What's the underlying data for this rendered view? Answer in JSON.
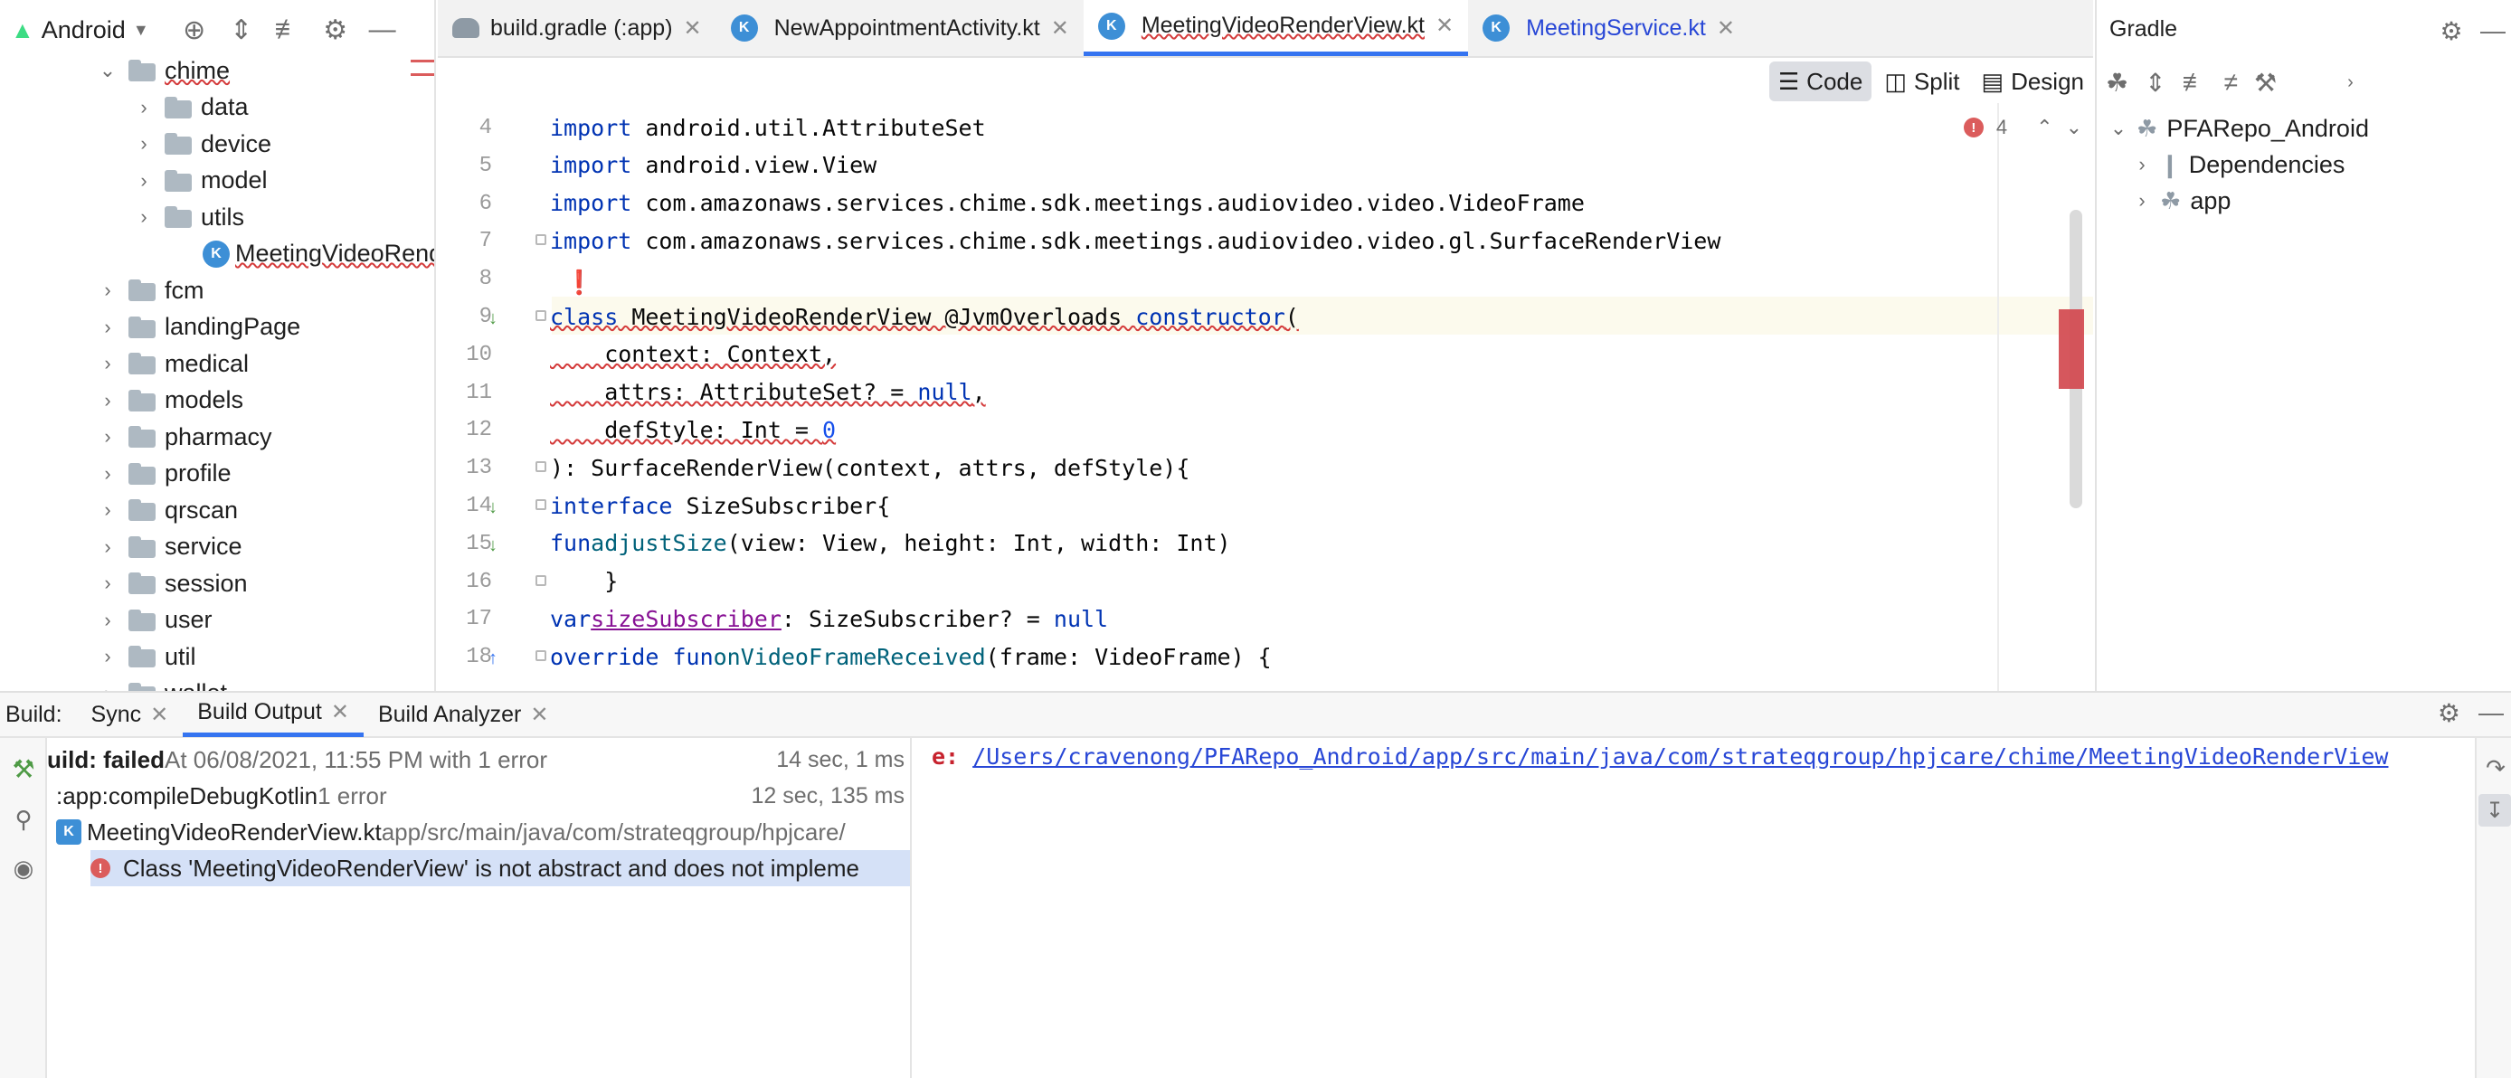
{
  "project_panel": {
    "view_label": "Android",
    "tree": [
      {
        "label": "chime",
        "level": 1,
        "expanded": true,
        "type": "folder",
        "squiggle": true
      },
      {
        "label": "data",
        "level": 2,
        "expanded": false,
        "type": "folder"
      },
      {
        "label": "device",
        "level": 2,
        "expanded": false,
        "type": "folder"
      },
      {
        "label": "model",
        "level": 2,
        "expanded": false,
        "type": "folder"
      },
      {
        "label": "utils",
        "level": 2,
        "expanded": false,
        "type": "folder"
      },
      {
        "label": "MeetingVideoRend",
        "level": 2,
        "expanded": false,
        "type": "kotlin-file",
        "squiggle": true
      },
      {
        "label": "fcm",
        "level": 0,
        "expanded": false,
        "type": "folder"
      },
      {
        "label": "landingPage",
        "level": 0,
        "expanded": false,
        "type": "folder"
      },
      {
        "label": "medical",
        "level": 0,
        "expanded": false,
        "type": "folder"
      },
      {
        "label": "models",
        "level": 0,
        "expanded": false,
        "type": "folder"
      },
      {
        "label": "pharmacy",
        "level": 0,
        "expanded": false,
        "type": "folder"
      },
      {
        "label": "profile",
        "level": 0,
        "expanded": false,
        "type": "folder"
      },
      {
        "label": "qrscan",
        "level": 0,
        "expanded": false,
        "type": "folder"
      },
      {
        "label": "service",
        "level": 0,
        "expanded": false,
        "type": "folder"
      },
      {
        "label": "session",
        "level": 0,
        "expanded": false,
        "type": "folder"
      },
      {
        "label": "user",
        "level": 0,
        "expanded": false,
        "type": "folder"
      },
      {
        "label": "util",
        "level": 0,
        "expanded": false,
        "type": "folder"
      },
      {
        "label": "wallet",
        "level": 0,
        "expanded": false,
        "type": "folder"
      }
    ]
  },
  "editor_tabs": [
    {
      "label": "build.gradle (:app)",
      "icon": "gradle-icon",
      "active": false
    },
    {
      "label": "NewAppointmentActivity.kt",
      "icon": "kotlin-file-icon",
      "active": false
    },
    {
      "label": "MeetingVideoRenderView.kt",
      "icon": "kotlin-file-icon",
      "active": true
    },
    {
      "label": "MeetingService.kt",
      "icon": "kotlin-file-icon",
      "active": false
    }
  ],
  "view_modes": {
    "code": "Code",
    "split": "Split",
    "design": "Design"
  },
  "inspection": {
    "error_count": "4"
  },
  "code_lines": [
    {
      "n": "4",
      "html": "<span class='kw'>import</span> android.util.AttributeSet"
    },
    {
      "n": "5",
      "html": "<span class='kw'>import</span> android.view.View"
    },
    {
      "n": "6",
      "html": "<span class='kw'>import</span> com.amazonaws.services.chime.sdk.meetings.audiovideo.video.VideoFrame"
    },
    {
      "n": "7",
      "html": "<span class='kw'>import</span> com.amazonaws.services.chime.sdk.meetings.audiovideo.video.gl.SurfaceRenderView"
    },
    {
      "n": "8",
      "html": ""
    },
    {
      "n": "9",
      "html": "<span class='kw squiggle'>class</span><span class='squiggle'> MeetingVideoRenderView @JvmOverloads </span><span class='kw squiggle'>constructor</span><span class='squiggle'>(</span>"
    },
    {
      "n": "10",
      "html": "<span class='squiggle'>    context: Context,</span>"
    },
    {
      "n": "11",
      "html": "<span class='squiggle'>    attrs: AttributeSet? = </span><span class='kw squiggle'>null</span><span class='squiggle'>,</span>"
    },
    {
      "n": "12",
      "html": "<span class='squiggle'>    defStyle: Int = </span><span class='num squiggle'>0</span>"
    },
    {
      "n": "13",
      "html": "): SurfaceRenderView(context, attrs, defStyle){"
    },
    {
      "n": "14",
      "html": "    <span class='kw'>interface</span> SizeSubscriber{"
    },
    {
      "n": "15",
      "html": "        <span class='kw'>fun</span> <span class='fn'>adjustSize</span>(view: View, height: Int, width: Int)"
    },
    {
      "n": "16",
      "html": "    }"
    },
    {
      "n": "17",
      "html": "    <span class='kw'>var</span> <span class='prop'>sizeSubscriber</span>: SizeSubscriber? = <span class='kw'>null</span>"
    },
    {
      "n": "18",
      "html": "    <span class='kw'>override fun</span> <span class='fn'>onVideoFrameReceived</span>(frame: VideoFrame) {"
    }
  ],
  "gradle": {
    "title": "Gradle",
    "tree": [
      {
        "label": "PFARepo_Android",
        "level": 0,
        "expanded": true
      },
      {
        "label": "Dependencies",
        "level": 1,
        "expanded": false
      },
      {
        "label": "app",
        "level": 1,
        "expanded": false
      }
    ]
  },
  "build": {
    "label": "Build:",
    "tabs": [
      {
        "label": "Sync",
        "active": false
      },
      {
        "label": "Build Output",
        "active": true
      },
      {
        "label": "Build Analyzer",
        "active": false
      }
    ],
    "rows": [
      {
        "main": "uild: failed",
        "detail": " At 06/08/2021, 11:55 PM with 1 error",
        "time": "14 sec, 1 ms"
      },
      {
        "main": ":app:compileDebugKotlin",
        "detail": "  1 error",
        "time": "12 sec, 135 ms"
      },
      {
        "main": "MeetingVideoRenderView.kt",
        "detail": " app/src/main/java/com/strateqgroup/hpjcare/",
        "time": ""
      },
      {
        "main": "Class 'MeetingVideoRenderView' is not abstract and does not impleme",
        "detail": "",
        "time": ""
      }
    ],
    "console": {
      "prefix": "e: ",
      "link": "/Users/cravenong/PFARepo_Android/app/src/main/java/com/strateqgroup/hpjcare/chime/MeetingVideoRenderView"
    }
  },
  "colors": {
    "accent": "#3574f0",
    "error": "#db5c5c",
    "keyword": "#0033b3"
  }
}
